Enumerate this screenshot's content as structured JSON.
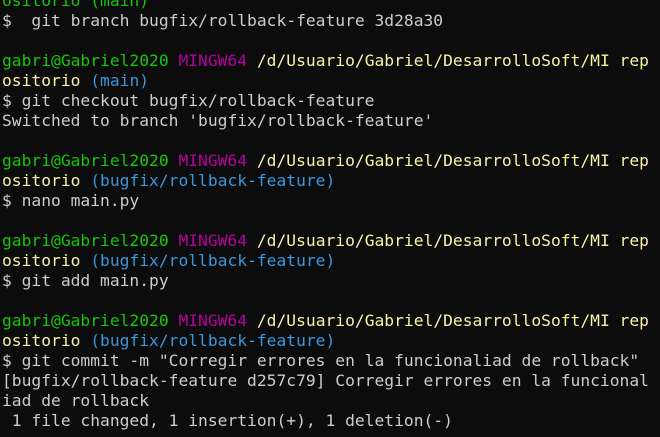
{
  "colors": {
    "background": "#0c0c0c",
    "foreground": "#cccccc",
    "user_host": "#16c60c",
    "msystem": "#b4009e",
    "path": "#f9f1a5",
    "branch": "#3a96dd"
  },
  "terminal": {
    "lines": [
      [
        {
          "text": "ositorio (main)",
          "style": "user"
        }
      ],
      [
        {
          "text": "$  git branch bugfix/rollback-feature 3d28a30",
          "style": "plain"
        }
      ],
      [],
      [
        {
          "text": "gabri@Gabriel2020 ",
          "style": "user"
        },
        {
          "text": "MINGW64 ",
          "style": "sys"
        },
        {
          "text": "/d/Usuario/Gabriel/DesarrolloSoft/MI rep",
          "style": "path"
        }
      ],
      [
        {
          "text": "ositorio ",
          "style": "path"
        },
        {
          "text": "(main)",
          "style": "branch"
        }
      ],
      [
        {
          "text": "$ git checkout bugfix/rollback-feature",
          "style": "plain"
        }
      ],
      [
        {
          "text": "Switched to branch 'bugfix/rollback-feature'",
          "style": "plain"
        }
      ],
      [],
      [
        {
          "text": "gabri@Gabriel2020 ",
          "style": "user"
        },
        {
          "text": "MINGW64 ",
          "style": "sys"
        },
        {
          "text": "/d/Usuario/Gabriel/DesarrolloSoft/MI rep",
          "style": "path"
        }
      ],
      [
        {
          "text": "ositorio ",
          "style": "path"
        },
        {
          "text": "(bugfix/rollback-feature)",
          "style": "branch"
        }
      ],
      [
        {
          "text": "$ nano main.py",
          "style": "plain"
        }
      ],
      [],
      [
        {
          "text": "gabri@Gabriel2020 ",
          "style": "user"
        },
        {
          "text": "MINGW64 ",
          "style": "sys"
        },
        {
          "text": "/d/Usuario/Gabriel/DesarrolloSoft/MI rep",
          "style": "path"
        }
      ],
      [
        {
          "text": "ositorio ",
          "style": "path"
        },
        {
          "text": "(bugfix/rollback-feature)",
          "style": "branch"
        }
      ],
      [
        {
          "text": "$ git add main.py",
          "style": "plain"
        }
      ],
      [],
      [
        {
          "text": "gabri@Gabriel2020 ",
          "style": "user"
        },
        {
          "text": "MINGW64 ",
          "style": "sys"
        },
        {
          "text": "/d/Usuario/Gabriel/DesarrolloSoft/MI rep",
          "style": "path"
        }
      ],
      [
        {
          "text": "ositorio ",
          "style": "path"
        },
        {
          "text": "(bugfix/rollback-feature)",
          "style": "branch"
        }
      ],
      [
        {
          "text": "$ git commit -m \"Corregir errores en la funcionaliad de rollback\"",
          "style": "plain"
        }
      ],
      [
        {
          "text": "[bugfix/rollback-feature d257c79] Corregir errores en la funcional",
          "style": "plain"
        }
      ],
      [
        {
          "text": "iad de rollback",
          "style": "plain"
        }
      ],
      [
        {
          "text": " 1 file changed, 1 insertion(+), 1 deletion(-)",
          "style": "plain"
        }
      ]
    ]
  }
}
